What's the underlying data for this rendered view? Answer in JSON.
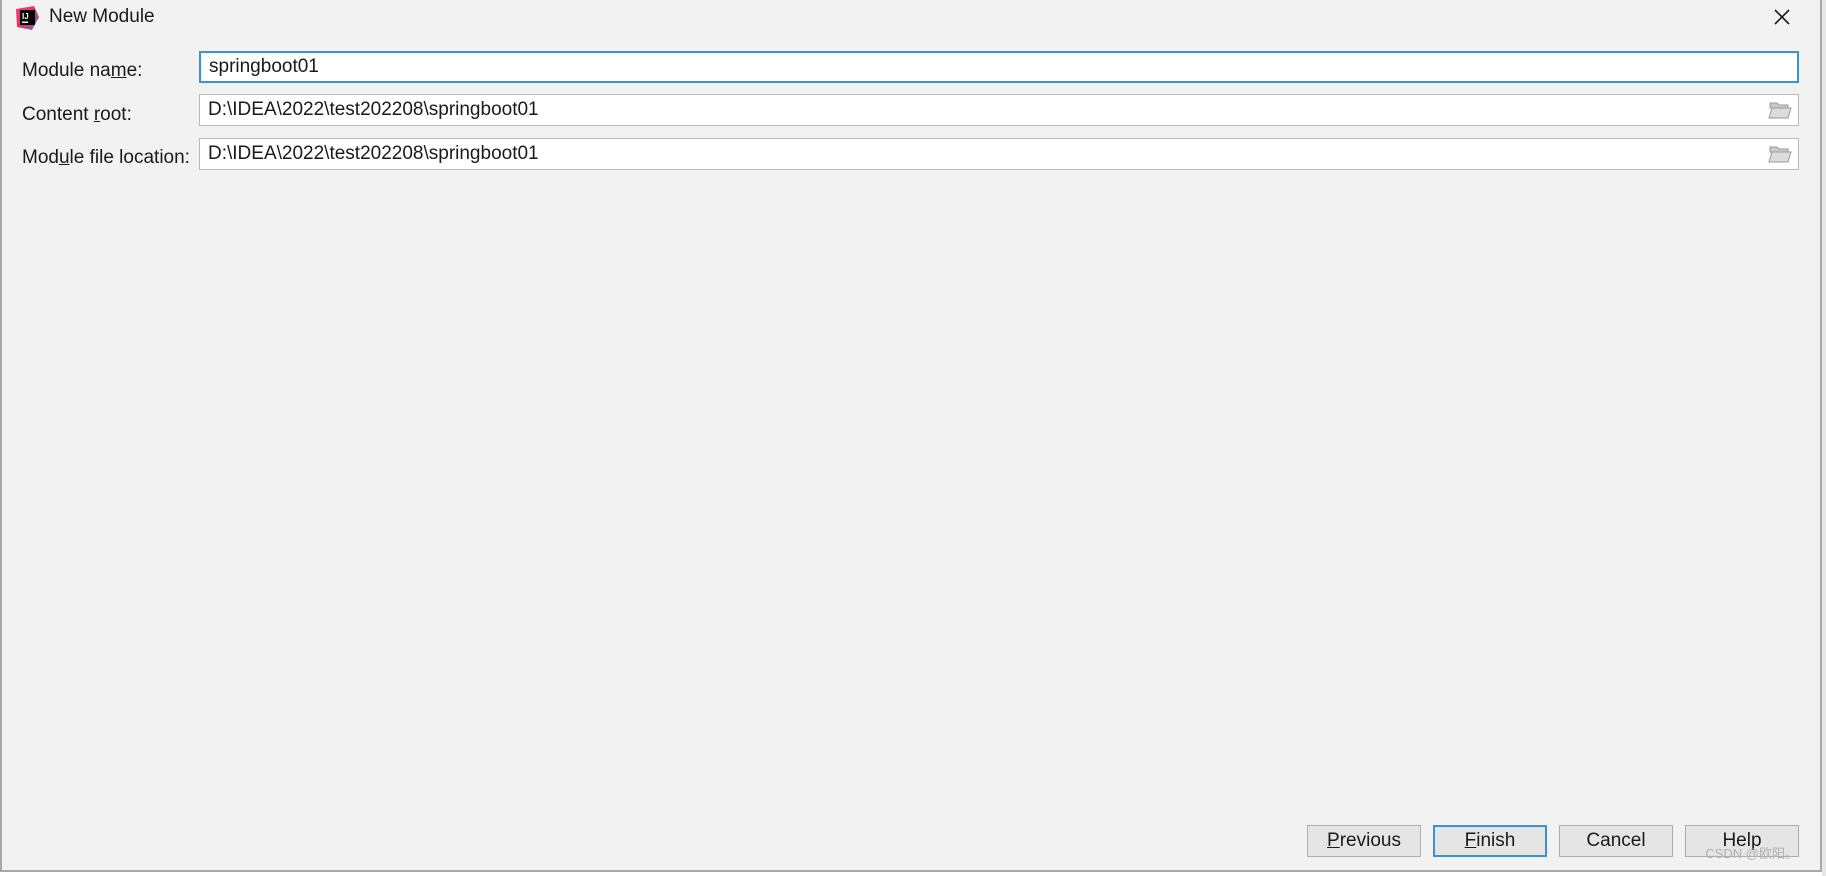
{
  "window": {
    "title": "New Module",
    "icon": "intellij-idea-icon",
    "close_icon": "close-icon"
  },
  "form": {
    "module_name": {
      "label_pre": "Module na",
      "label_mnemonic": "m",
      "label_post": "e:",
      "value": "springboot01"
    },
    "content_root": {
      "label_pre": "Content ",
      "label_mnemonic": "r",
      "label_post": "oot:",
      "value": "D:\\IDEA\\2022\\test202208\\springboot01"
    },
    "module_file_location": {
      "label_pre": "Mod",
      "label_mnemonic": "u",
      "label_post": "le file location:",
      "value": "D:\\IDEA\\2022\\test202208\\springboot01"
    }
  },
  "buttons": {
    "previous": {
      "mnemonic": "P",
      "rest": "revious"
    },
    "finish": {
      "mnemonic": "F",
      "rest": "inish"
    },
    "cancel": {
      "label": "Cancel"
    },
    "help": {
      "label": "Help"
    }
  },
  "watermark": "CSDN @欧阳。",
  "colors": {
    "dialog_bg": "#f2f2f2",
    "focus_border": "#3d8fd6",
    "field_border": "#b9b9b9"
  }
}
